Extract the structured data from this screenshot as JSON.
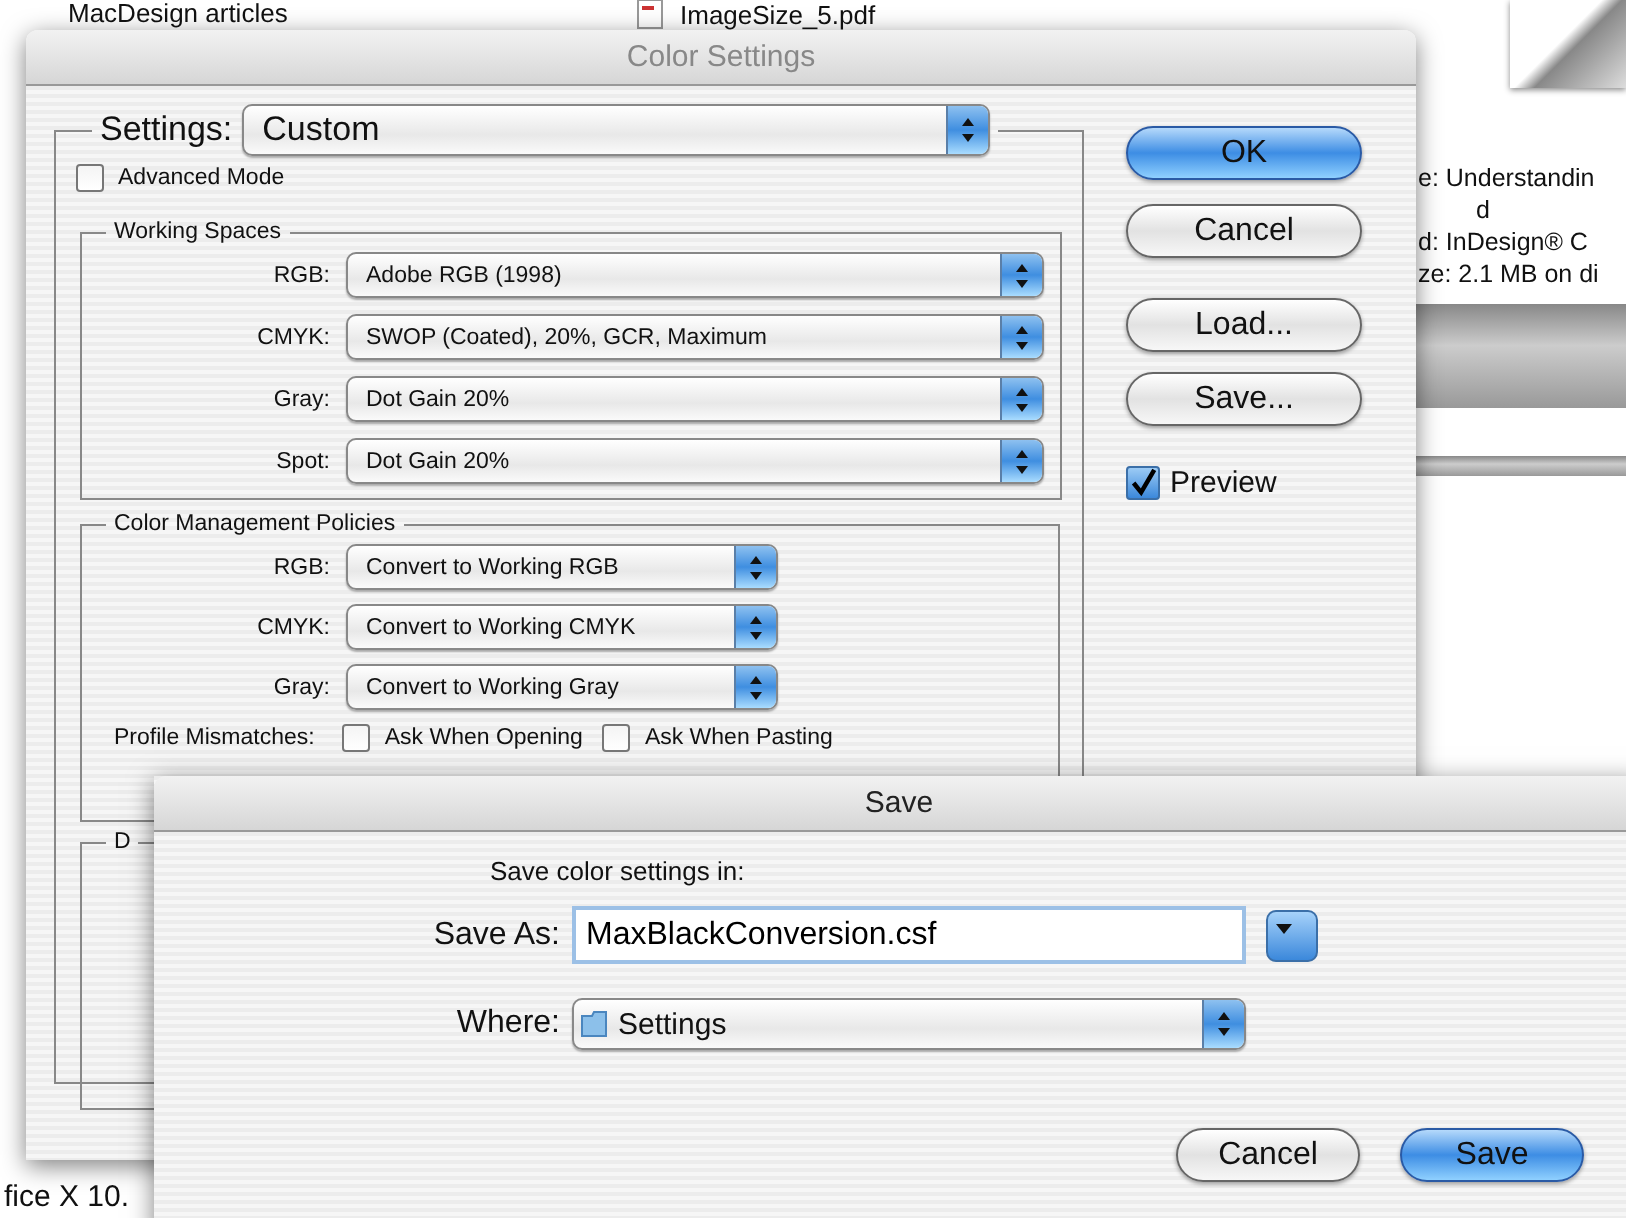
{
  "desktop": {
    "folder_title": "MacDesign articles",
    "file_name": "ImageSize_5.pdf",
    "info_lines": [
      "e: Understandin",
      "d",
      "d: InDesign® C",
      "ze: 2.1 MB on di"
    ],
    "bottom_text": "fice X 10."
  },
  "color_settings": {
    "title": "Color Settings",
    "settings": {
      "label": "Settings:",
      "value": "Custom"
    },
    "advanced_mode": {
      "label": "Advanced Mode",
      "checked": false
    },
    "working_spaces": {
      "title": "Working Spaces",
      "rows": [
        {
          "label": "RGB:",
          "value": "Adobe RGB (1998)"
        },
        {
          "label": "CMYK:",
          "value": "SWOP (Coated), 20%, GCR, Maximum"
        },
        {
          "label": "Gray:",
          "value": "Dot Gain 20%"
        },
        {
          "label": "Spot:",
          "value": "Dot Gain 20%"
        }
      ]
    },
    "policies": {
      "title": "Color Management Policies",
      "rows": [
        {
          "label": "RGB:",
          "value": "Convert to Working RGB"
        },
        {
          "label": "CMYK:",
          "value": "Convert to Working CMYK"
        },
        {
          "label": "Gray:",
          "value": "Convert to Working Gray"
        }
      ],
      "mismatches": {
        "label": "Profile Mismatches:",
        "options": [
          {
            "label": "Ask When Opening",
            "checked": false
          },
          {
            "label": "Ask When Pasting",
            "checked": false
          }
        ]
      }
    },
    "group_3": {
      "title": "D"
    },
    "buttons": [
      {
        "label": "OK",
        "default": true
      },
      {
        "label": "Cancel",
        "default": false
      },
      {
        "label": "Load...",
        "default": false
      },
      {
        "label": "Save...",
        "default": false
      }
    ],
    "preview": {
      "label": "Preview",
      "checked": true
    }
  },
  "save_sheet": {
    "title": "Save",
    "prompt": "Save color settings in:",
    "save_as": {
      "label": "Save As:",
      "value": "MaxBlackConversion.csf"
    },
    "where": {
      "label": "Where:",
      "value": "Settings"
    },
    "buttons": [
      {
        "label": "Cancel",
        "default": false
      },
      {
        "label": "Save",
        "default": true
      }
    ]
  }
}
